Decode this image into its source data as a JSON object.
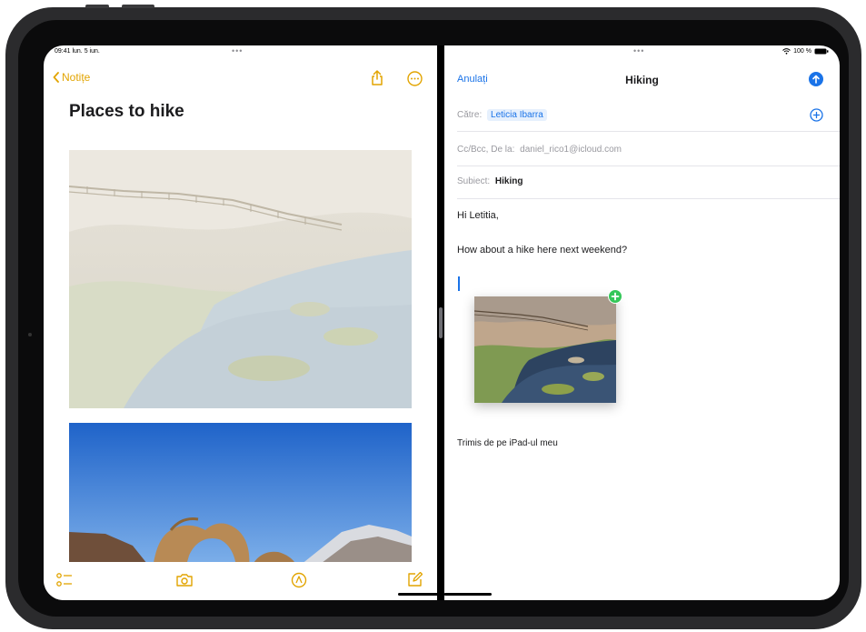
{
  "left": {
    "status_time": "09:41 lun. 5 iun.",
    "back_label": "Notițe",
    "note_title": "Places to hike",
    "icons": [
      "share-icon",
      "more-icon",
      "checklist-icon",
      "camera-icon",
      "markup-icon",
      "compose-icon"
    ]
  },
  "right": {
    "status_right": "100 %",
    "cancel_label": "Anulați",
    "title": "Hiking",
    "to_label": "Către:",
    "to_value": "Leticia Ibarra",
    "ccbcc_label": "Cc/Bcc, De la:",
    "ccbcc_value": "daniel_rico1@icloud.com",
    "subject_label": "Subiect:",
    "subject_value": "Hiking",
    "greeting": "Hi Letitia,",
    "message": "How about a hike here next weekend?",
    "signature": "Trimis de pe iPad-ul meu"
  },
  "colors": {
    "notes_accent": "#e2a400",
    "mail_accent": "#1a73e8",
    "add_badge": "#34c759"
  }
}
